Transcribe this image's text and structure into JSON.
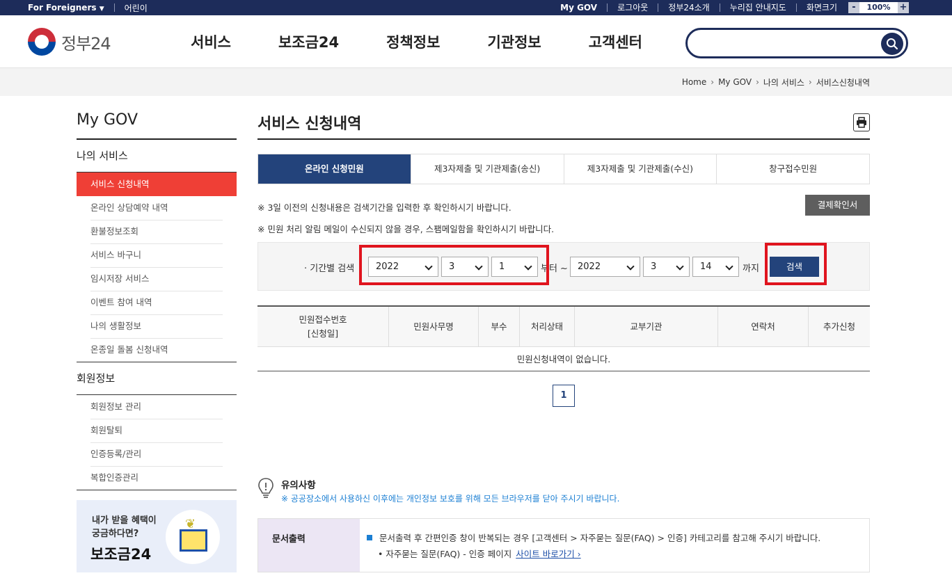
{
  "topbar": {
    "foreigners": "For Foreigners",
    "kids": "어린이",
    "links": [
      "My GOV",
      "로그아웃",
      "정부24소개",
      "누리집 안내지도",
      "화면크기"
    ],
    "zoom_minus": "-",
    "zoom_value": "100%",
    "zoom_plus": "+"
  },
  "header": {
    "logo_text": "정부24",
    "nav": [
      "서비스",
      "보조금24",
      "정책정보",
      "기관정보",
      "고객센터"
    ],
    "search_value": ""
  },
  "breadcrumb": [
    "Home",
    "My GOV",
    "나의 서비스",
    "서비스신청내역"
  ],
  "sidebar": {
    "title": "My GOV",
    "section1": "나의 서비스",
    "items1": [
      "서비스 신청내역",
      "온라인 상담예약 내역",
      "환불정보조회",
      "서비스 바구니",
      "임시저장 서비스",
      "이벤트 참여 내역",
      "나의 생활정보",
      "온종일 돌봄 신청내역"
    ],
    "section2": "회원정보",
    "items2": [
      "회원정보 관리",
      "회원탈퇴",
      "인증등록/관리",
      "복합인증관리"
    ],
    "banner_line1": "내가 받을 혜택이",
    "banner_line2": "궁금하다면?",
    "banner_title": "보조금24"
  },
  "main": {
    "title": "서비스 신청내역",
    "tabs": [
      "온라인 신청민원",
      "제3자제출 및 기관제출(송신)",
      "제3자제출 및 기관제출(수신)",
      "창구접수민원"
    ],
    "note1": "※ 3일 이전의 신청내용은 검색기간을 입력한 후 확인하시기 바랍니다.",
    "note2": "※ 민원 처리 알림 메일이 수신되지 않을 경우, 스팸메일함을 확인하시기 바랍니다.",
    "receipt_button": "결제확인서",
    "filter": {
      "label": "· 기간별 검색",
      "from_year": "2022",
      "from_month": "3",
      "from_day": "1",
      "from_text": "부터 ~",
      "to_year": "2022",
      "to_month": "3",
      "to_day": "14",
      "to_text": "까지",
      "search_button": "검색"
    },
    "table": {
      "headers": [
        "민원접수번호\n[신청일]",
        "민원사무명",
        "부수",
        "처리상태",
        "교부기관",
        "연락처",
        "추가신청"
      ],
      "empty": "민원신청내역이 없습니다."
    },
    "page": "1",
    "caution_title": "유의사항",
    "caution_text": "※ 공공장소에서 사용하신 이후에는 개인정보 보호를 위해 모든 브라우저를 닫아 주시기 바랍니다.",
    "info": {
      "label": "문서출력",
      "line1": "문서출력 후 간편인증 창이 반복되는 경우 [고객센터 > 자주묻는 질문(FAQ) > 인증] 카테고리를 참고해 주시기 바랍니다.",
      "line2": "• 자주묻는 질문(FAQ) - 인증 페이지",
      "link": "사이트 바로가기 ›"
    }
  }
}
